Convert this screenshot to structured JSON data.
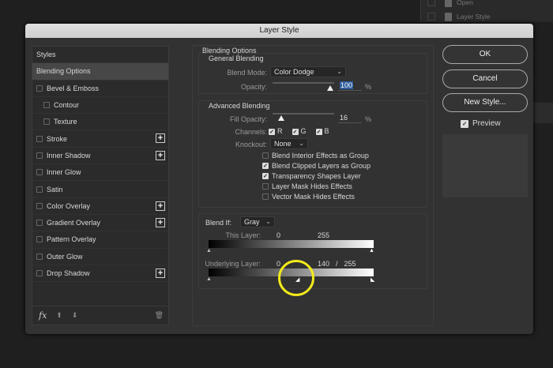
{
  "background_panel": {
    "items": [
      "Open",
      "Layer Style"
    ]
  },
  "dialog": {
    "title": "Layer Style"
  },
  "styles_list": {
    "header": "Styles",
    "items": [
      {
        "label": "Blending Options",
        "selected": true
      },
      {
        "label": "Bevel & Emboss",
        "checked": false
      },
      {
        "label": "Contour",
        "checked": false,
        "indent": true
      },
      {
        "label": "Texture",
        "checked": false,
        "indent": true
      },
      {
        "label": "Stroke",
        "checked": false,
        "plus": true
      },
      {
        "label": "Inner Shadow",
        "checked": false,
        "plus": true
      },
      {
        "label": "Inner Glow",
        "checked": false
      },
      {
        "label": "Satin",
        "checked": false
      },
      {
        "label": "Color Overlay",
        "checked": false,
        "plus": true
      },
      {
        "label": "Gradient Overlay",
        "checked": false,
        "plus": true
      },
      {
        "label": "Pattern Overlay",
        "checked": false
      },
      {
        "label": "Outer Glow",
        "checked": false
      },
      {
        "label": "Drop Shadow",
        "checked": false,
        "plus": true
      }
    ],
    "footer": {
      "fx": "fx"
    }
  },
  "blending": {
    "title": "Blending Options",
    "general": {
      "title": "General Blending",
      "blend_mode_label": "Blend Mode:",
      "blend_mode": "Color Dodge",
      "opacity_label": "Opacity:",
      "opacity": "100",
      "opacity_unit": "%",
      "opacity_value": 100
    },
    "advanced": {
      "title": "Advanced Blending",
      "fill_label": "Fill Opacity:",
      "fill": "16",
      "fill_unit": "%",
      "fill_value": 16,
      "channels_label": "Channels:",
      "channels": [
        "R",
        "G",
        "B"
      ],
      "knockout_label": "Knockout:",
      "knockout": "None",
      "options": [
        {
          "label": "Blend Interior Effects as Group",
          "checked": false
        },
        {
          "label": "Blend Clipped Layers as Group",
          "checked": true
        },
        {
          "label": "Transparency Shapes Layer",
          "checked": true
        },
        {
          "label": "Layer Mask Hides Effects",
          "checked": false
        },
        {
          "label": "Vector Mask Hides Effects",
          "checked": false
        }
      ]
    },
    "blend_if": {
      "label": "Blend If:",
      "value": "Gray",
      "this_layer": {
        "label": "This Layer:",
        "low": "0",
        "high": "255"
      },
      "underlying": {
        "label": "Underlying Layer:",
        "low": "0",
        "high_split": "140",
        "slash": "/",
        "high": "255"
      }
    }
  },
  "buttons": {
    "ok": "OK",
    "cancel": "Cancel",
    "new_style": "New Style...",
    "preview": "Preview"
  },
  "colors": {
    "highlight": "#f2ea1b",
    "selection": "#2f5d9e"
  }
}
